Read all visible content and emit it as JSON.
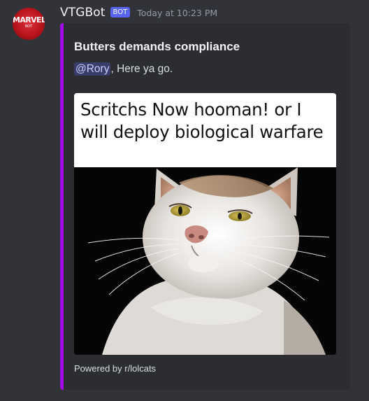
{
  "author": {
    "avatar_text": "MARVEL",
    "avatar_subtext": "BOT",
    "username": "VTGBot",
    "bot_tag": "BOT",
    "timestamp": "Today at 10:23 PM"
  },
  "embed": {
    "accent_color": "#a30ce8",
    "title": "Butters demands compliance",
    "mention": "@Rory",
    "description_suffix": ", Here ya go.",
    "image_caption": "Scritchs Now hooman! or I will deploy biological warfare",
    "image_subject": "cat-photo",
    "footer": "Powered by r/lolcats"
  }
}
